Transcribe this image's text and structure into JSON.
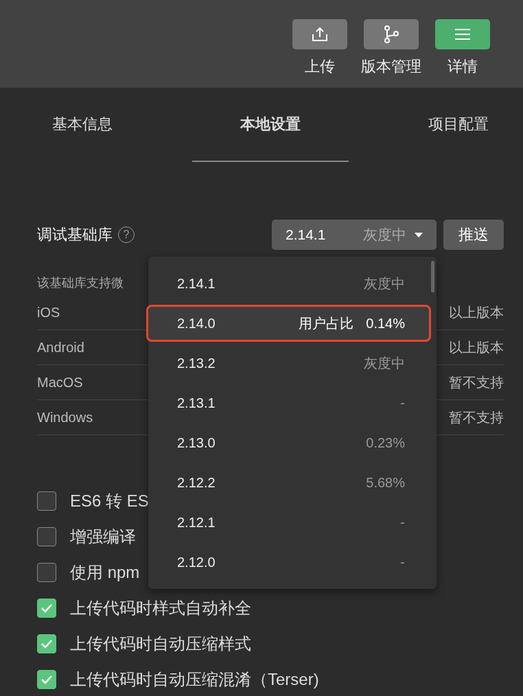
{
  "toolbar": {
    "buttons": [
      {
        "kind": "upload",
        "label": "上传",
        "primary": false
      },
      {
        "kind": "branch",
        "label": "版本管理",
        "primary": false
      },
      {
        "kind": "menu",
        "label": "详情",
        "primary": true
      }
    ]
  },
  "tabs": [
    {
      "label": "基本信息",
      "selected": false
    },
    {
      "label": "本地设置",
      "selected": true
    },
    {
      "label": "项目配置",
      "selected": false
    }
  ],
  "debug_library": {
    "label": "调试基础库",
    "help": "?",
    "version": "2.14.1",
    "status": "灰度中",
    "push_button": "推送"
  },
  "support": {
    "intro": "该基础库支持微",
    "rows": [
      {
        "platform": "iOS",
        "value": "以上版本"
      },
      {
        "platform": "Android",
        "value": "以上版本"
      },
      {
        "platform": "MacOS",
        "value": "暂不支持"
      },
      {
        "platform": "Windows",
        "value": "暂不支持"
      }
    ]
  },
  "options": [
    {
      "label": "ES6 转 ES",
      "checked": false
    },
    {
      "label": "增强编译",
      "checked": false
    },
    {
      "label": "使用 npm",
      "checked": false
    },
    {
      "label": "上传代码时样式自动补全",
      "checked": true
    },
    {
      "label": "上传代码时自动压缩样式",
      "checked": true
    },
    {
      "label": "上传代码时自动压缩混淆（Terser)",
      "checked": true
    }
  ],
  "dropdown": {
    "items": [
      {
        "version": "2.14.1",
        "info": "灰度中",
        "selected": false
      },
      {
        "version": "2.14.0",
        "share_label": "用户占比",
        "info": "0.14%",
        "selected": true
      },
      {
        "version": "2.13.2",
        "info": "灰度中",
        "selected": false
      },
      {
        "version": "2.13.1",
        "info": "-",
        "selected": false
      },
      {
        "version": "2.13.0",
        "info": "0.23%",
        "selected": false
      },
      {
        "version": "2.12.2",
        "info": "5.68%",
        "selected": false
      },
      {
        "version": "2.12.1",
        "info": "-",
        "selected": false
      },
      {
        "version": "2.12.0",
        "info": "-",
        "selected": false
      }
    ]
  }
}
